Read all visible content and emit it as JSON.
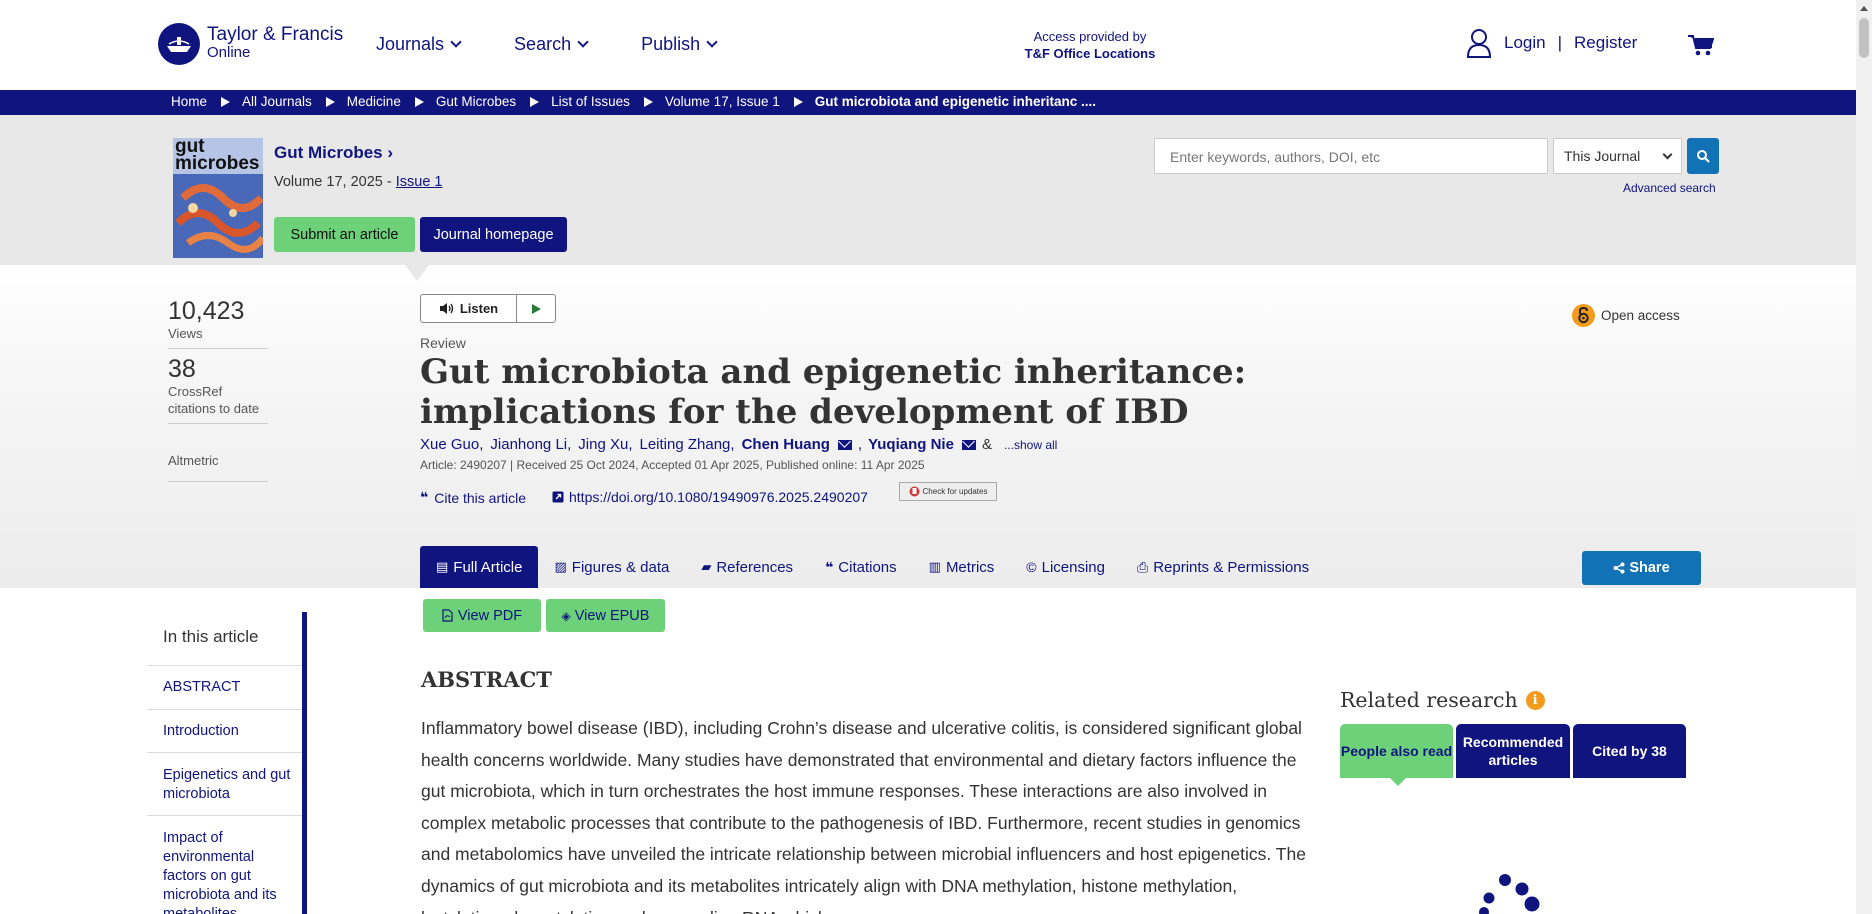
{
  "header": {
    "logo_line1": "Taylor & Francis",
    "logo_line2": "Online",
    "nav": [
      "Journals",
      "Search",
      "Publish"
    ],
    "access_line1": "Access provided by",
    "access_line2": "T&F Office Locations",
    "login": "Login",
    "separator": "|",
    "register": "Register"
  },
  "breadcrumb": [
    "Home",
    "All Journals",
    "Medicine",
    "Gut Microbes",
    "List of Issues",
    "Volume 17, Issue 1",
    "Gut microbiota and epigenetic inheritanc ...."
  ],
  "journal": {
    "cover_text_1": "gut",
    "cover_text_2": "microbes",
    "title": "Gut Microbes",
    "chevron": "›",
    "volume_prefix": "Volume 17, 2025 - ",
    "issue_link": "Issue 1",
    "submit_label": "Submit an article",
    "homepage_label": "Journal homepage"
  },
  "search": {
    "placeholder": "Enter keywords, authors, DOI, etc",
    "scope": "This Journal",
    "advanced": "Advanced search"
  },
  "stats": {
    "views_num": "10,423",
    "views_label": "Views",
    "crossref_num": "38",
    "crossref_label_1": "CrossRef",
    "crossref_label_2": "citations to date",
    "altmetric": "Altmetric"
  },
  "article": {
    "listen": "Listen",
    "open_access": "Open access",
    "type": "Review",
    "title": "Gut microbiota and epigenetic inheritance: implications for the development of IBD",
    "authors": [
      {
        "name": "Xue Guo,",
        "bold": false
      },
      {
        "name": "Jianhong Li,",
        "bold": false
      },
      {
        "name": "Jing Xu,",
        "bold": false
      },
      {
        "name": "Leiting Zhang,",
        "bold": false
      }
    ],
    "corresponding_1": "Chen Huang",
    "comma": ",",
    "corresponding_2": "Yuqiang Nie",
    "amp": "&",
    "show_all": "...show all",
    "meta": "Article: 2490207 | Received 25 Oct 2024, Accepted 01 Apr 2025, Published online: 11 Apr 2025",
    "cite": "Cite this article",
    "doi": "https://doi.org/10.1080/19490976.2025.2490207",
    "crossmark": "Check for updates"
  },
  "tabs": [
    {
      "label": "Full Article",
      "icon": "file-icon",
      "glyph": "🗎"
    },
    {
      "label": "Figures & data",
      "icon": "image-icon",
      "glyph": "▨"
    },
    {
      "label": "References",
      "icon": "book-icon",
      "glyph": "📘"
    },
    {
      "label": "Citations",
      "icon": "quote-icon",
      "glyph": "❝"
    },
    {
      "label": "Metrics",
      "icon": "bar-chart-icon",
      "glyph": "▥"
    },
    {
      "label": "Licensing",
      "icon": "copyright-icon",
      "glyph": "©"
    },
    {
      "label": "Reprints & Permissions",
      "icon": "print-icon",
      "glyph": "⎙"
    }
  ],
  "share": "Share",
  "view_pdf": "View PDF",
  "view_epub": "View EPUB",
  "toc": {
    "heading": "In this article",
    "items": [
      "ABSTRACT",
      "Introduction",
      "Epigenetics and gut microbiota",
      "Impact of environmental factors on gut microbiota and its metabolites"
    ]
  },
  "abstract": {
    "heading": "ABSTRACT",
    "text": "Inflammatory bowel disease (IBD), including Crohn’s disease and ulcerative colitis, is considered significant global health concerns worldwide. Many studies have demonstrated that environmental and dietary factors influence the gut microbiota, which in turn orchestrates the host immune responses. These interactions are also involved in complex metabolic processes that contribute to the pathogenesis of IBD. Furthermore, recent studies in genomics and metabolomics have unveiled the intricate relationship between microbial influencers and host epigenetics. The dynamics of gut microbiota and its metabolites intricately align with DNA methylation, histone methylation, lactylation, deacetylation and non-coding RNA which are..."
  },
  "related": {
    "title": "Related research",
    "tabs": [
      "People also read",
      "Recommended articles",
      "Cited by 38"
    ]
  },
  "colors": {
    "brand_navy": "#10147e",
    "accent_green": "#6dd17a",
    "accent_blue": "#1272b6",
    "oa_orange": "#f29b1d"
  }
}
